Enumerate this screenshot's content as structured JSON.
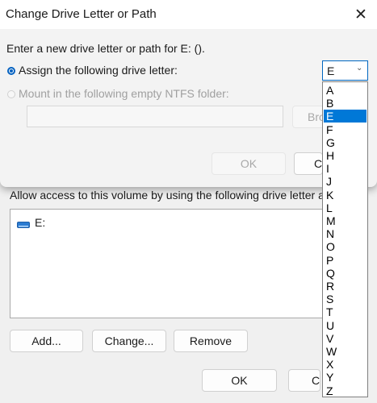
{
  "front_dialog": {
    "title": "Change Drive Letter or Path",
    "instruction": "Enter a new drive letter or path for E: ().",
    "assign_label": "Assign the following drive letter:",
    "mount_label": "Mount in the following empty NTFS folder:",
    "browse_label": "Bro",
    "ok_label": "OK",
    "cancel_label": "C",
    "folder_path_value": ""
  },
  "drive_select": {
    "selected": "E",
    "options": [
      "A",
      "B",
      "E",
      "F",
      "G",
      "H",
      "I",
      "J",
      "K",
      "L",
      "M",
      "N",
      "O",
      "P",
      "Q",
      "R",
      "S",
      "T",
      "U",
      "V",
      "W",
      "X",
      "Y",
      "Z"
    ]
  },
  "back_dialog": {
    "access_label": "Allow access to this volume by using the following drive letter and p",
    "list_items": [
      {
        "label": "E:",
        "icon": "drive-icon"
      }
    ],
    "add_label": "Add...",
    "change_label": "Change...",
    "remove_label": "Remove",
    "ok_label": "OK",
    "cancel_label": "Ca"
  },
  "colors": {
    "accent": "#0067c0",
    "selection": "#0078d7"
  }
}
